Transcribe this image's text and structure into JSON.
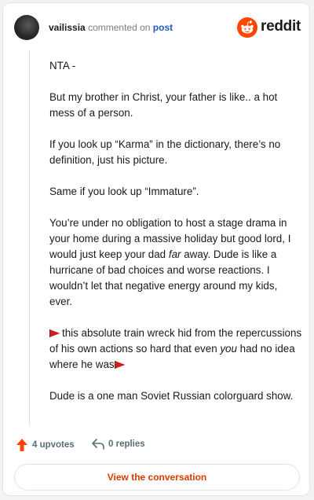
{
  "header": {
    "username": "vailissia",
    "verb": "commented on",
    "post_link": "post",
    "brand": "reddit"
  },
  "comment": {
    "p1": "NTA -",
    "p2": "But my brother in Christ, your father is like.. a hot mess of a person.",
    "p3": "If you look up “Karma” in the dictionary, there’s no definition, just his picture.",
    "p4": "Same if you look up “Immature”.",
    "p5_before": "You’re under no obligation to host a stage drama in your home during a massive holiday but good lord, I would just keep your dad ",
    "p5_em": "far",
    "p5_after": " away. Dude is like a hurricane of bad choices and worse reactions. I wouldn’t let that negative energy around my kids, ever.",
    "p6_before": "this absolute train wreck hid from the repercussions of his own actions so hard that even ",
    "p6_em": "you",
    "p6_after": " had no idea where he was",
    "p7": "Dude is a one man Soviet Russian colorguard show."
  },
  "footer": {
    "upvotes": "4 upvotes",
    "replies": "0 replies",
    "view_button": "View the conversation"
  },
  "colors": {
    "accent": "#d93a00",
    "upvote": "#ff4500",
    "link": "#1e5ab8",
    "flag": "#cc1f1a"
  },
  "icons": [
    "reddit-logo-icon",
    "upvote-arrow-icon",
    "reply-arrow-icon",
    "red-flag-icon"
  ]
}
